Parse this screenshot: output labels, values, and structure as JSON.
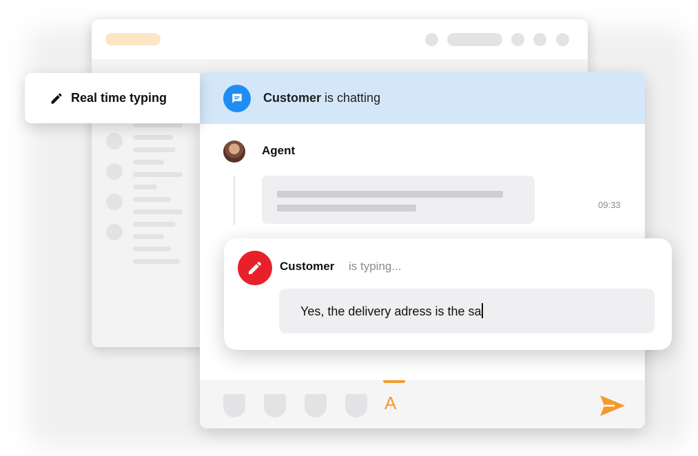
{
  "feature_label": {
    "text": "Real time typing",
    "icon": "pencil-icon"
  },
  "chat_header": {
    "name": "Customer",
    "status": "is chatting",
    "icon": "chat-bubble-icon",
    "background": "#d3e7f9",
    "icon_color": "#1f8df4"
  },
  "agent_message": {
    "name": "Agent",
    "time": "09:33",
    "avatar": "agent-avatar"
  },
  "typing_indicator": {
    "name": "Customer",
    "status": "is typing...",
    "text": "Yes, the delivery adress is the sa",
    "icon": "pencil-icon",
    "icon_color": "#e8202a"
  },
  "toolbar": {
    "tools": [
      "tool-1",
      "tool-2",
      "tool-3",
      "tool-4"
    ],
    "active_tool_label": "A",
    "accent_color": "#f39a2c",
    "send_icon": "send-icon"
  }
}
